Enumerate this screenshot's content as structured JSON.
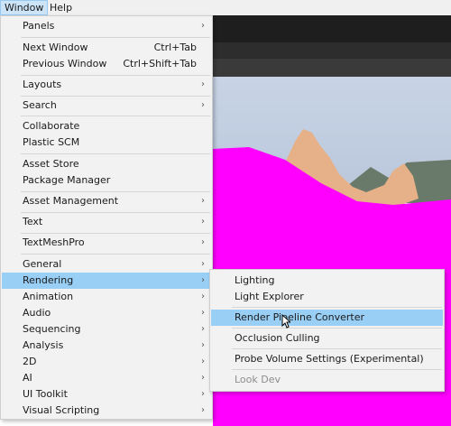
{
  "menubar": {
    "window": "Window",
    "help": "Help"
  },
  "menu": {
    "panels": "Panels",
    "next_window": "Next Window",
    "next_window_sc": "Ctrl+Tab",
    "previous_window": "Previous Window",
    "previous_window_sc": "Ctrl+Shift+Tab",
    "layouts": "Layouts",
    "search": "Search",
    "collaborate": "Collaborate",
    "plastic_scm": "Plastic SCM",
    "asset_store": "Asset Store",
    "package_manager": "Package Manager",
    "asset_management": "Asset Management",
    "text": "Text",
    "textmeshpro": "TextMeshPro",
    "general": "General",
    "rendering": "Rendering",
    "animation": "Animation",
    "audio": "Audio",
    "sequencing": "Sequencing",
    "analysis": "Analysis",
    "two_d": "2D",
    "ai": "AI",
    "ui_toolkit": "UI Toolkit",
    "visual_scripting": "Visual Scripting",
    "arrow": "›"
  },
  "submenu": {
    "lighting": "Lighting",
    "light_explorer": "Light Explorer",
    "render_pipeline_converter": "Render Pipeline Converter",
    "occlusion_culling": "Occlusion Culling",
    "probe_volume_settings": "Probe Volume Settings (Experimental)",
    "look_dev": "Look Dev"
  },
  "colors": {
    "highlight": "#99cef5",
    "scene_magenta": "#ff00ff",
    "sky": "#c4d2e8",
    "mountain": "#e2b088"
  }
}
